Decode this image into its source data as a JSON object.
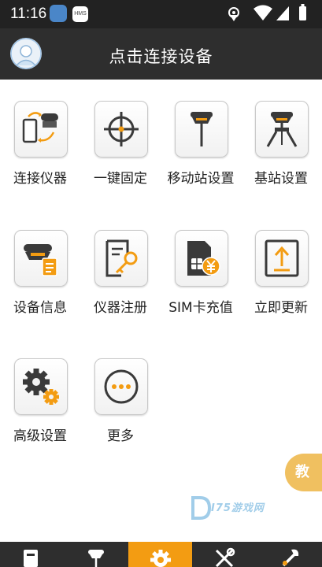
{
  "status_bar": {
    "time": "11:16",
    "app_badge": "HMS"
  },
  "header": {
    "title": "点击连接设备"
  },
  "grid": [
    {
      "label": "连接仪器",
      "icon": "connect-device-icon"
    },
    {
      "label": "一键固定",
      "icon": "crosshair-target-icon"
    },
    {
      "label": "移动站设置",
      "icon": "rover-antenna-icon"
    },
    {
      "label": "基站设置",
      "icon": "base-station-tripod-icon"
    },
    {
      "label": "设备信息",
      "icon": "device-info-icon"
    },
    {
      "label": "仪器注册",
      "icon": "register-key-icon"
    },
    {
      "label": "SIM卡充值",
      "icon": "sim-card-recharge-icon"
    },
    {
      "label": "立即更新",
      "icon": "update-upload-icon"
    },
    {
      "label": "高级设置",
      "icon": "advanced-gears-icon"
    },
    {
      "label": "更多",
      "icon": "more-dots-icon"
    }
  ],
  "side_tab": {
    "label": "教"
  },
  "bottom_nav": {
    "active_index": 2,
    "items": [
      "device-nav-icon",
      "rover-nav-icon",
      "settings-gear-nav-icon",
      "tools-nav-icon",
      "wrench-nav-icon"
    ]
  },
  "colors": {
    "accent": "#f39c12",
    "header": "#2e2e2e",
    "icon_dark": "#3a3a3a"
  }
}
